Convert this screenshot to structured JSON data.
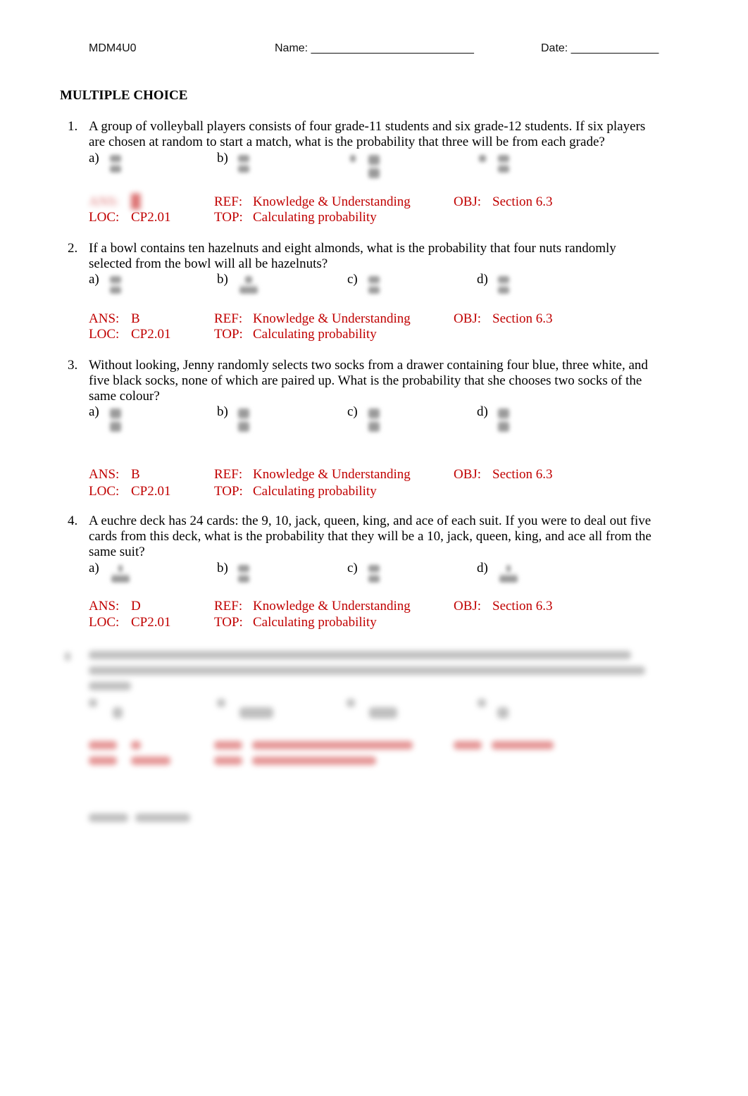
{
  "header": {
    "course": "MDM4U0",
    "name_label": "Name: __________________________",
    "date_label": "Date: ______________"
  },
  "section_title": "MULTIPLE CHOICE",
  "meta_labels": {
    "ans": "ANS:",
    "ref": "REF:",
    "obj": "OBJ:",
    "loc": "LOC:",
    "top": "TOP:"
  },
  "questions": [
    {
      "number": "1.",
      "text": "A group of volleyball players consists of four grade-11 students and six grade-12 students. If six players are chosen at random to start a match, what is the probability that three will be from each grade?",
      "options": [
        "a)",
        "b)",
        "",
        ""
      ],
      "answer": "",
      "ref": "Knowledge & Understanding",
      "obj": "Section 6.3",
      "loc": "CP2.01",
      "topic": "Calculating probability"
    },
    {
      "number": "2.",
      "text": "If a bowl contains ten hazelnuts and eight almonds, what is the probability that four nuts randomly selected from the bowl will all be hazelnuts?",
      "options": [
        "a)",
        "b)",
        "c)",
        "d)"
      ],
      "answer": "B",
      "ref": "Knowledge & Understanding",
      "obj": "Section 6.3",
      "loc": "CP2.01",
      "topic": "Calculating probability"
    },
    {
      "number": "3.",
      "text": "Without looking, Jenny randomly selects two socks from a drawer containing four blue, three white, and five black socks, none of which are paired up. What is the probability that she chooses two socks of the same colour?",
      "options": [
        "a)",
        "b)",
        "c)",
        "d)"
      ],
      "answer": "B",
      "ref": "Knowledge & Understanding",
      "obj": "Section 6.3",
      "loc": "CP2.01",
      "topic": "Calculating probability"
    },
    {
      "number": "4.",
      "text": "A euchre deck has 24 cards: the 9, 10, jack, queen, king, and ace of each suit. If you were to deal out five cards from this deck, what is the probability that they will be a 10, jack, queen, king, and ace all from the same suit?",
      "options": [
        "a)",
        "b)",
        "c)",
        "d)"
      ],
      "answer": "D",
      "ref": "Knowledge & Understanding",
      "obj": "Section 6.3",
      "loc": "CP2.01",
      "topic": "Calculating probability"
    }
  ]
}
